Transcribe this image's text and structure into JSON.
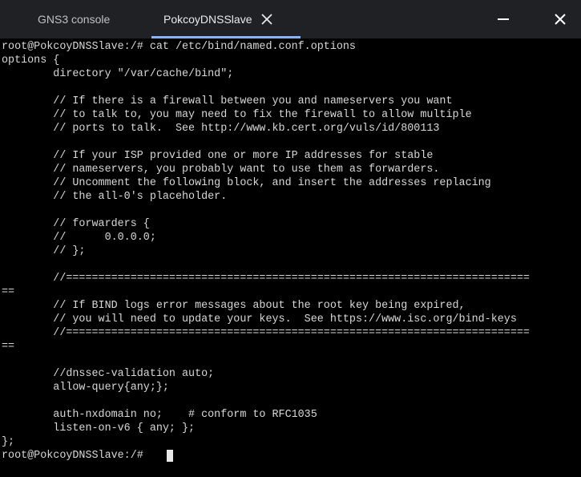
{
  "tabs": {
    "gns3_console": "GNS3 console",
    "active_tab": "PokcoyDNSSlave"
  },
  "icons": {
    "tab_close": "close-icon",
    "minimize": "minimize-icon",
    "window_close": "close-icon"
  },
  "colors": {
    "titlebar": "#202124",
    "accent": "#8ab4f8",
    "terminal_bg": "#000000",
    "terminal_text": "#d8d8d8"
  },
  "terminal": {
    "lines": [
      "root@PokcoyDNSSlave:/# cat /etc/bind/named.conf.options",
      "options {",
      "        directory \"/var/cache/bind\";",
      "",
      "        // If there is a firewall between you and nameservers you want",
      "        // to talk to, you may need to fix the firewall to allow multiple",
      "        // ports to talk.  See http://www.kb.cert.org/vuls/id/800113",
      "",
      "        // If your ISP provided one or more IP addresses for stable",
      "        // nameservers, you probably want to use them as forwarders.",
      "        // Uncomment the following block, and insert the addresses replacing",
      "        // the all-0's placeholder.",
      "",
      "        // forwarders {",
      "        //      0.0.0.0;",
      "        // };",
      "",
      "        //========================================================================",
      "==",
      "        // If BIND logs error messages about the root key being expired,",
      "        // you will need to update your keys.  See https://www.isc.org/bind-keys",
      "        //========================================================================",
      "==",
      "",
      "        //dnssec-validation auto;",
      "        allow-query{any;};",
      "",
      "        auth-nxdomain no;    # conform to RFC1035",
      "        listen-on-v6 { any; };",
      "};",
      "",
      "root@PokcoyDNSSlave:/# "
    ]
  }
}
